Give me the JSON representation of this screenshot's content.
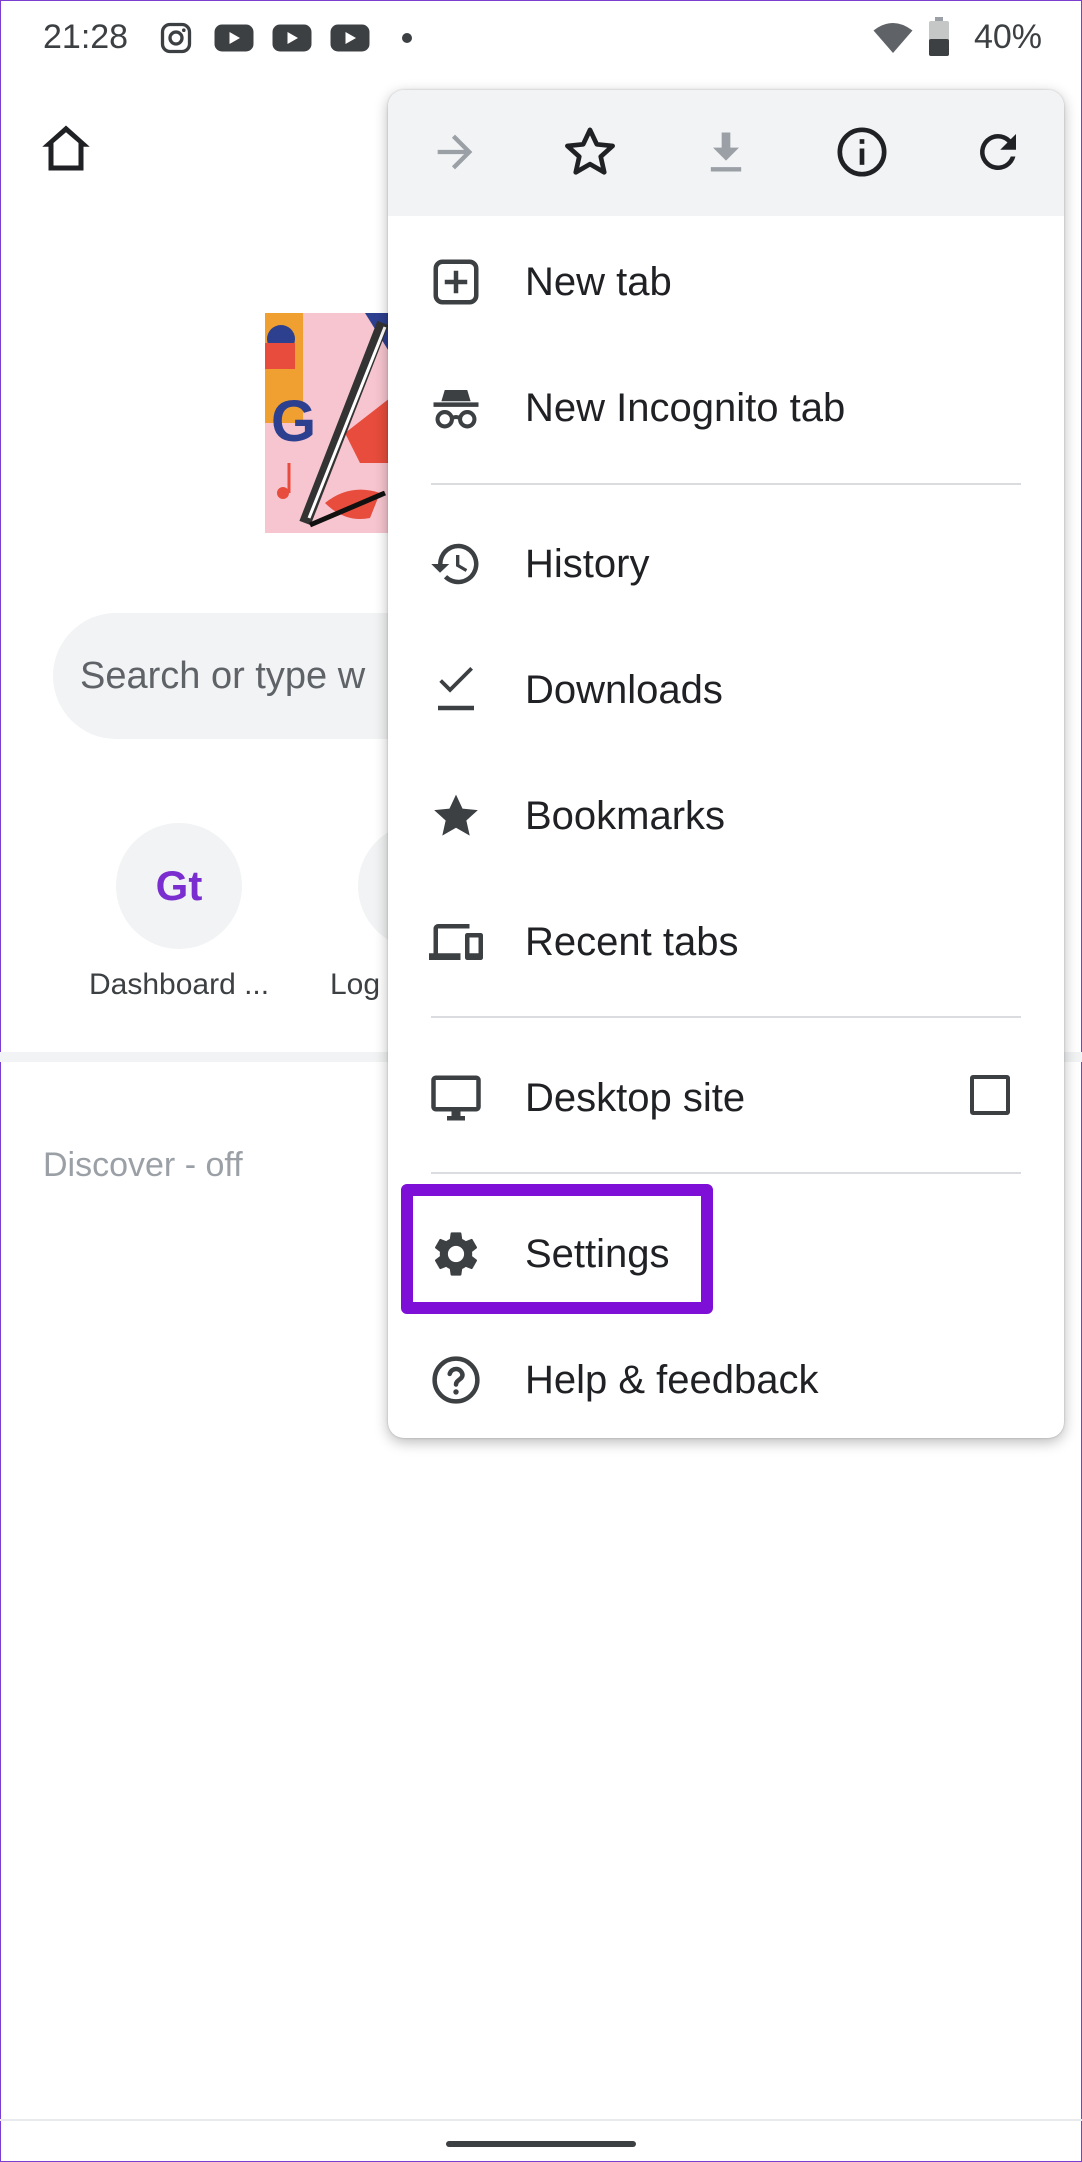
{
  "status_bar": {
    "time": "21:28",
    "notification_icons": [
      "instagram-icon",
      "youtube-icon",
      "youtube-icon",
      "youtube-icon",
      "dot-icon"
    ],
    "battery_percent": "40%"
  },
  "page": {
    "search_placeholder": "Search or type w",
    "shortcuts": [
      {
        "label": "Dashboard ...",
        "icon": "gt-logo-icon"
      },
      {
        "label": "Log"
      }
    ],
    "discover_label": "Discover - off"
  },
  "menu": {
    "toolbar": [
      "forward-icon",
      "bookmark-star-icon",
      "download-icon",
      "info-icon",
      "reload-icon"
    ],
    "items": [
      {
        "label": "New tab",
        "icon": "new-tab-icon"
      },
      {
        "label": "New Incognito tab",
        "icon": "incognito-icon"
      },
      {
        "label": "History",
        "icon": "history-icon"
      },
      {
        "label": "Downloads",
        "icon": "downloads-icon"
      },
      {
        "label": "Bookmarks",
        "icon": "star-icon"
      },
      {
        "label": "Recent tabs",
        "icon": "devices-icon"
      },
      {
        "label": "Desktop site",
        "icon": "desktop-icon",
        "checked": false
      },
      {
        "label": "Settings",
        "icon": "gear-icon",
        "highlighted": true
      },
      {
        "label": "Help & feedback",
        "icon": "help-icon"
      }
    ]
  },
  "colors": {
    "highlight": "#7e0fd6",
    "toolbar_bg": "#f1f3f4",
    "icon": "#3c4043"
  }
}
